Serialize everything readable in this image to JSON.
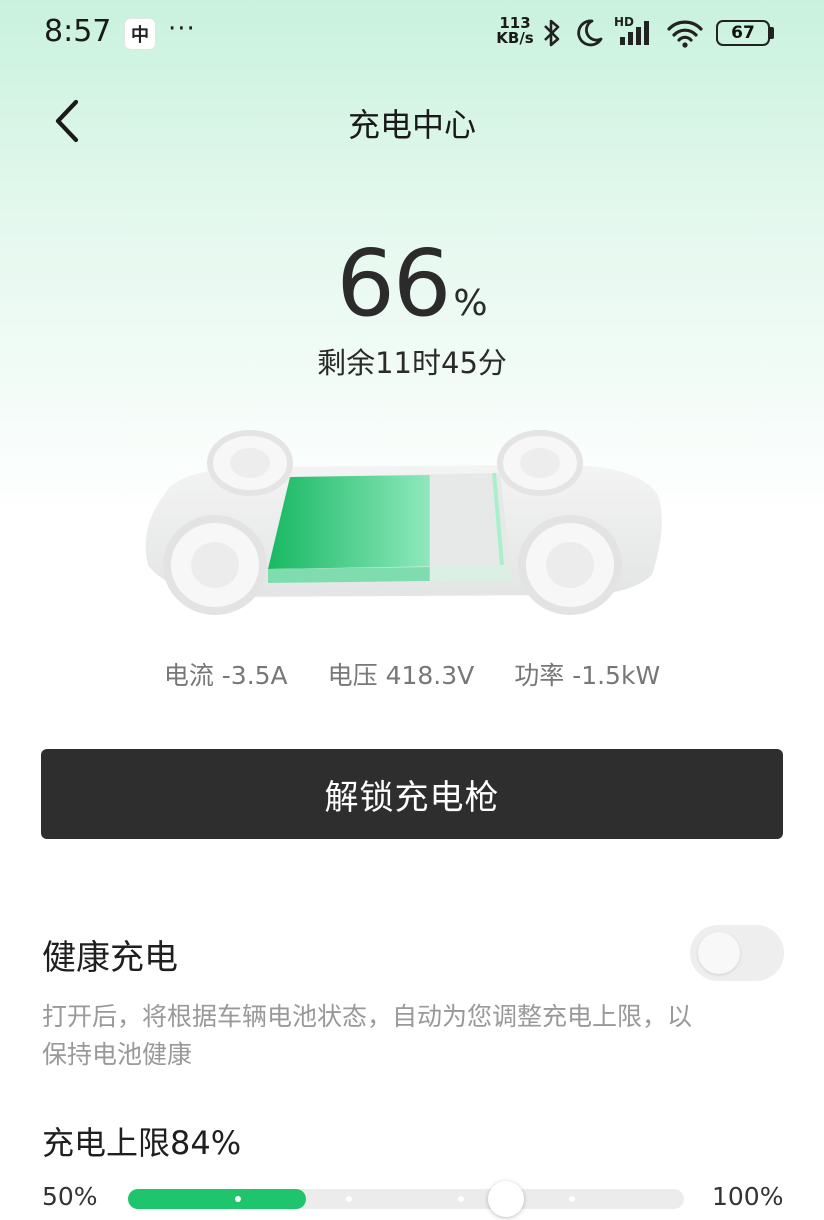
{
  "status_bar": {
    "time": "8:57",
    "app_icon_glyph": "中",
    "more": "···",
    "net_speed_value": "113",
    "net_speed_unit": "KB/s",
    "signal_label": "HD",
    "battery": "67",
    "icons": [
      "bluetooth-icon",
      "moon-icon",
      "signal-icon",
      "wifi-icon",
      "battery-icon"
    ]
  },
  "header": {
    "title": "充电中心",
    "back_icon": "chevron-left-icon"
  },
  "charge": {
    "percent": "66",
    "percent_unit": "%",
    "level_fraction": 0.66,
    "remaining": "剩余11时45分"
  },
  "stats": [
    {
      "label": "电流",
      "value": "-3.5A"
    },
    {
      "label": "电压",
      "value": "418.3V"
    },
    {
      "label": "功率",
      "value": "-1.5kW"
    }
  ],
  "unlock_button": {
    "label": "解锁充电枪"
  },
  "health_charging": {
    "title": "健康充电",
    "enabled": false,
    "description": "打开后，将根据车辆电池状态，自动为您调整充电上限，以保持电池健康"
  },
  "charge_limit": {
    "label": "充电上限",
    "value": "84%",
    "min_label": "50%",
    "max_label": "100%",
    "min": 50,
    "max": 100,
    "value_num": 84,
    "fill_to": 66
  },
  "colors": {
    "accent": "#1fc56c",
    "button_bg": "#2e2e2e"
  }
}
